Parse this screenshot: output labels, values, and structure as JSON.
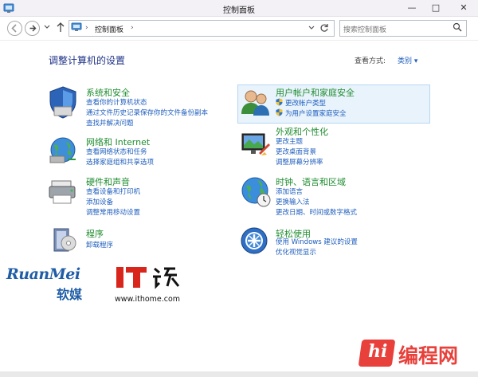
{
  "window": {
    "title": "控制面板",
    "buttons": {
      "minimize": "—",
      "maximize": "□",
      "close": "✕"
    }
  },
  "address": {
    "breadcrumb": "控制面板",
    "separator": "›"
  },
  "search": {
    "placeholder": "搜索控制面板"
  },
  "main": {
    "heading": "调整计算机的设置",
    "view_by_label": "查看方式:",
    "view_by_value": "类别 ▾"
  },
  "categories": {
    "system": {
      "title": "系统和安全",
      "links": [
        "查看你的计算机状态",
        "通过文件历史记录保存你的文件备份副本",
        "查找并解决问题"
      ]
    },
    "network": {
      "title": "网络和 Internet",
      "links": [
        "查看网络状态和任务",
        "选择家庭组和共享选项"
      ]
    },
    "hardware": {
      "title": "硬件和声音",
      "links": [
        "查看设备和打印机",
        "添加设备",
        "调整常用移动设置"
      ]
    },
    "programs": {
      "title": "程序",
      "links": [
        "卸载程序"
      ]
    },
    "users": {
      "title": "用户帐户和家庭安全",
      "links": [
        "更改帐户类型",
        "为用户设置家庭安全"
      ]
    },
    "appearance": {
      "title": "外观和个性化",
      "links": [
        "更改主题",
        "更改桌面背景",
        "调整屏幕分辨率"
      ]
    },
    "clock": {
      "title": "时钟、语言和区域",
      "links": [
        "添加语言",
        "更换输入法",
        "更改日期、时间或数字格式"
      ]
    },
    "ease": {
      "title": "轻松使用",
      "links": [
        "使用 Windows 建议的设置",
        "优化视觉显示"
      ]
    }
  },
  "watermarks": {
    "ruanmei_latin": "RuanMei",
    "ruanmei_cn": "软媒",
    "ithome_logo": "IT之家",
    "ithome_url": "www.ithome.com",
    "biancheng": "编程网"
  },
  "colors": {
    "link": "#1e5ebd",
    "category": "#1e8c2f",
    "heading": "#1e3287",
    "highlight_bg": "#e9f3fc"
  }
}
